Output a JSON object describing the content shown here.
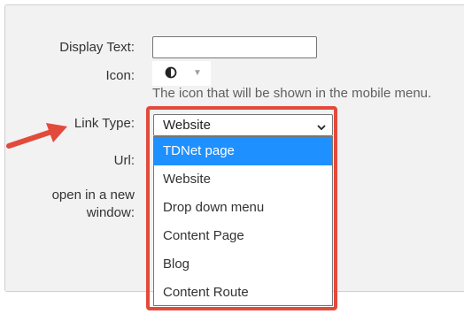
{
  "form": {
    "display_text_label": "Display Text:",
    "display_text_value": "",
    "icon_label": "Icon:",
    "icon_help": "The icon that will be shown in the mobile menu.",
    "link_type_label": "Link Type:",
    "link_type_value": "Website",
    "url_label": "Url:",
    "new_window_label_line1": "open in a new",
    "new_window_label_line2": "window:"
  },
  "dropdown": {
    "options": [
      {
        "label": "TDNet page",
        "highlighted": true
      },
      {
        "label": "Website",
        "highlighted": false
      },
      {
        "label": "Drop down menu",
        "highlighted": false
      },
      {
        "label": "Content Page",
        "highlighted": false
      },
      {
        "label": "Blog",
        "highlighted": false
      },
      {
        "label": "Content Route",
        "highlighted": false
      }
    ]
  },
  "colors": {
    "highlight": "#1e90ff",
    "annotation": "#e24a3b"
  },
  "icons": {
    "icon_picker_glyph": "half-circle-icon",
    "icon_picker_caret": "caret-down-icon",
    "select_chevron": "chevron-down-icon",
    "annotation_arrow": "arrow-right-icon"
  }
}
